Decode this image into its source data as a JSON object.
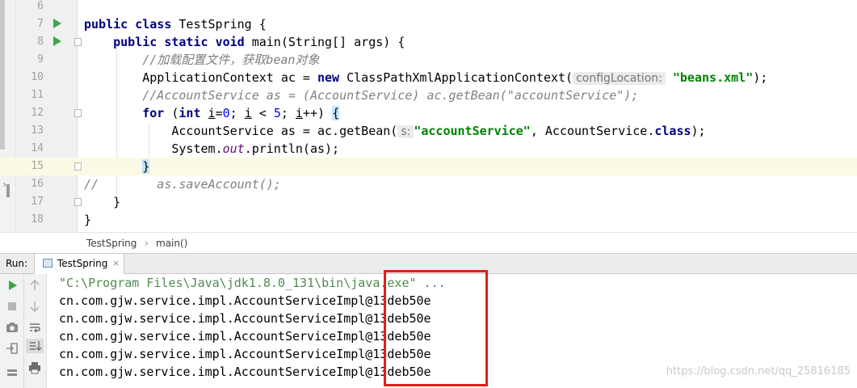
{
  "editor": {
    "lines": [
      {
        "num": "6"
      },
      {
        "num": "7",
        "tokens": [
          {
            "t": "kw",
            "v": "public "
          },
          {
            "t": "kw",
            "v": "class "
          },
          {
            "t": "p",
            "v": "TestSpring {"
          }
        ]
      },
      {
        "num": "8",
        "tokens": [
          {
            "t": "p",
            "v": "    "
          },
          {
            "t": "kw",
            "v": "public "
          },
          {
            "t": "kw",
            "v": "static "
          },
          {
            "t": "kw",
            "v": "void "
          },
          {
            "t": "p",
            "v": "main(String[] args) {"
          }
        ]
      },
      {
        "num": "9",
        "tokens": [
          {
            "t": "p",
            "v": "        "
          },
          {
            "t": "cm",
            "v": "//加载配置文件，获取bean对象"
          }
        ]
      },
      {
        "num": "10",
        "tokens": [
          {
            "t": "p",
            "v": "        ApplicationContext ac = "
          },
          {
            "t": "kw",
            "v": "new "
          },
          {
            "t": "p",
            "v": "ClassPathXmlApplicationContext("
          },
          {
            "t": "hint",
            "v": "configLocation:"
          },
          {
            "t": "p",
            "v": " "
          },
          {
            "t": "str",
            "v": "\"beans.xml\""
          },
          {
            "t": "p",
            "v": ");"
          }
        ]
      },
      {
        "num": "11",
        "tokens": [
          {
            "t": "p",
            "v": "        "
          },
          {
            "t": "cm",
            "v": "//AccountService as = (AccountService) ac.getBean(\"accountService\");"
          }
        ]
      },
      {
        "num": "12",
        "tokens": [
          {
            "t": "p",
            "v": "        "
          },
          {
            "t": "kw",
            "v": "for "
          },
          {
            "t": "p",
            "v": "("
          },
          {
            "t": "kw",
            "v": "int "
          },
          {
            "t": "ul",
            "v": "i"
          },
          {
            "t": "p",
            "v": "="
          },
          {
            "t": "num",
            "v": "0"
          },
          {
            "t": "p",
            "v": "; "
          },
          {
            "t": "ul",
            "v": "i"
          },
          {
            "t": "p",
            "v": " < "
          },
          {
            "t": "num",
            "v": "5"
          },
          {
            "t": "p",
            "v": "; "
          },
          {
            "t": "ul",
            "v": "i"
          },
          {
            "t": "p",
            "v": "++) "
          },
          {
            "t": "brace",
            "v": "{"
          }
        ]
      },
      {
        "num": "13",
        "tokens": [
          {
            "t": "p",
            "v": "            AccountService as = ac.getBean("
          },
          {
            "t": "hint",
            "v": "s:"
          },
          {
            "t": "str",
            "v": "\"accountService\""
          },
          {
            "t": "p",
            "v": ", AccountService."
          },
          {
            "t": "kw",
            "v": "class"
          },
          {
            "t": "p",
            "v": ");"
          }
        ]
      },
      {
        "num": "14",
        "tokens": [
          {
            "t": "p",
            "v": "            System."
          },
          {
            "t": "fld",
            "v": "out"
          },
          {
            "t": "p",
            "v": ".println(as);"
          }
        ]
      },
      {
        "num": "15",
        "current": true,
        "tokens": [
          {
            "t": "p",
            "v": "        "
          },
          {
            "t": "brace",
            "v": "}"
          }
        ]
      },
      {
        "num": "16",
        "tokens": [
          {
            "t": "cm",
            "v": "//        as.saveAccount();"
          }
        ]
      },
      {
        "num": "17",
        "tokens": [
          {
            "t": "p",
            "v": "    }"
          }
        ]
      },
      {
        "num": "18",
        "tokens": [
          {
            "t": "p",
            "v": "}"
          }
        ]
      }
    ]
  },
  "breadcrumbs": {
    "items": [
      "TestSpring",
      "main()"
    ],
    "separator": "›"
  },
  "run_panel": {
    "label": "Run:",
    "tab_label": "TestSpring",
    "close_glyph": "×"
  },
  "console": {
    "lines": [
      "\"C:\\Program Files\\Java\\jdk1.8.0_131\\bin\\java.exe\" ...",
      "cn.com.gjw.service.impl.AccountServiceImpl@13deb50e",
      "cn.com.gjw.service.impl.AccountServiceImpl@13deb50e",
      "cn.com.gjw.service.impl.AccountServiceImpl@13deb50e",
      "cn.com.gjw.service.impl.AccountServiceImpl@13deb50e",
      "cn.com.gjw.service.impl.AccountServiceImpl@13deb50e"
    ]
  },
  "watermark": "https://blog.csdn.net/qq_25816185",
  "icons": {
    "run": "run-icon",
    "stop": "stop-icon",
    "camera": "camera-icon",
    "login": "login-icon",
    "up": "up-arrow-icon",
    "down": "down-arrow-icon",
    "wrap": "soft-wrap-icon",
    "scroll_end": "scroll-to-end-icon",
    "print": "print-icon"
  },
  "colors": {
    "keyword": "#000080",
    "string": "#008000",
    "comment": "#808080",
    "number": "#0000ff",
    "highlight_box": "#e0201a",
    "current_line": "#fcfae5",
    "run_green": "#3aa64c"
  }
}
